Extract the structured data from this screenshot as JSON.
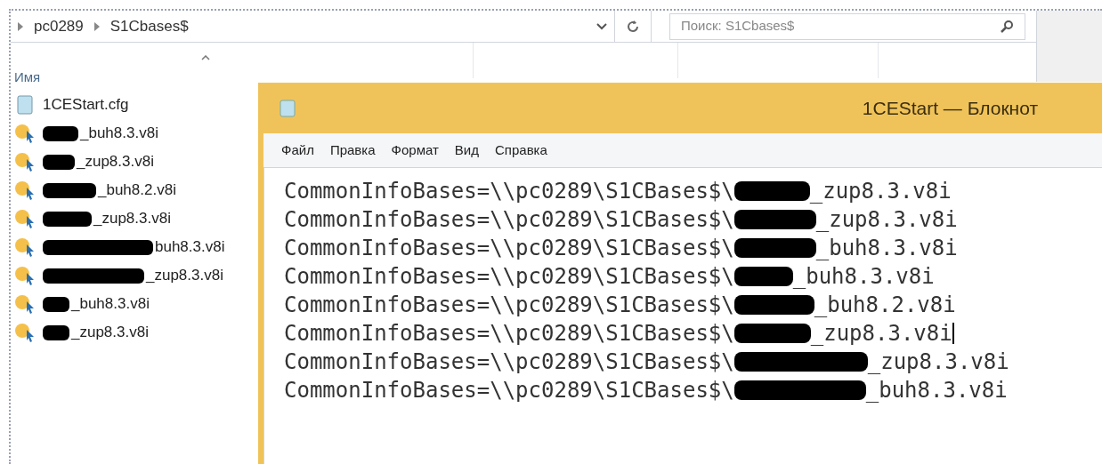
{
  "explorer": {
    "breadcrumb": [
      "pc0289",
      "S1Cbases$"
    ],
    "search": {
      "placeholder": "Поиск: S1Cbases$"
    },
    "columns": [
      "Имя"
    ],
    "files": [
      {
        "kind": "cfg",
        "name": "1CEStart.cfg",
        "redacted": false
      },
      {
        "kind": "v8i",
        "name": "_buh8.3.v8i",
        "redacted": true
      },
      {
        "kind": "v8i",
        "name": "_zup8.3.v8i",
        "redacted": true
      },
      {
        "kind": "v8i",
        "name": "_buh8.2.v8i",
        "redacted": true
      },
      {
        "kind": "v8i",
        "name": "_zup8.3.v8i",
        "redacted": true
      },
      {
        "kind": "v8i",
        "name": "buh8.3.v8i",
        "redacted": true
      },
      {
        "kind": "v8i",
        "name": "_zup8.3.v8i",
        "redacted": true
      },
      {
        "kind": "v8i",
        "name": "_buh8.3.v8i",
        "redacted": true
      },
      {
        "kind": "v8i",
        "name": "_zup8.3.v8i",
        "redacted": true
      }
    ]
  },
  "notepad": {
    "title": "1CEStart — Блокнот",
    "menu": [
      "Файл",
      "Правка",
      "Формат",
      "Вид",
      "Справка"
    ],
    "lines": [
      {
        "before": "CommonInfoBases=\\\\pc0289\\S1CBases$\\",
        "after": "_zup8.3.v8i",
        "cursor": false
      },
      {
        "before": "CommonInfoBases=\\\\pc0289\\S1CBases$\\",
        "after": "_zup8.3.v8i",
        "cursor": false
      },
      {
        "before": "CommonInfoBases=\\\\pc0289\\S1CBases$\\",
        "after": "_buh8.3.v8i",
        "cursor": false
      },
      {
        "before": "CommonInfoBases=\\\\pc0289\\S1CBases$\\",
        "after": "_buh8.3.v8i",
        "cursor": false
      },
      {
        "before": "CommonInfoBases=\\\\pc0289\\S1CBases$\\",
        "after": "_buh8.2.v8i",
        "cursor": false
      },
      {
        "before": "CommonInfoBases=\\\\pc0289\\S1CBases$\\",
        "after": "_zup8.3.v8i",
        "cursor": true
      },
      {
        "before": "CommonInfoBases=\\\\pc0289\\S1CBases$\\",
        "after": "_zup8.3.v8i",
        "cursor": false
      },
      {
        "before": "CommonInfoBases=\\\\pc0289\\S1CBases$\\",
        "after": "_buh8.3.v8i",
        "cursor": false
      }
    ]
  }
}
